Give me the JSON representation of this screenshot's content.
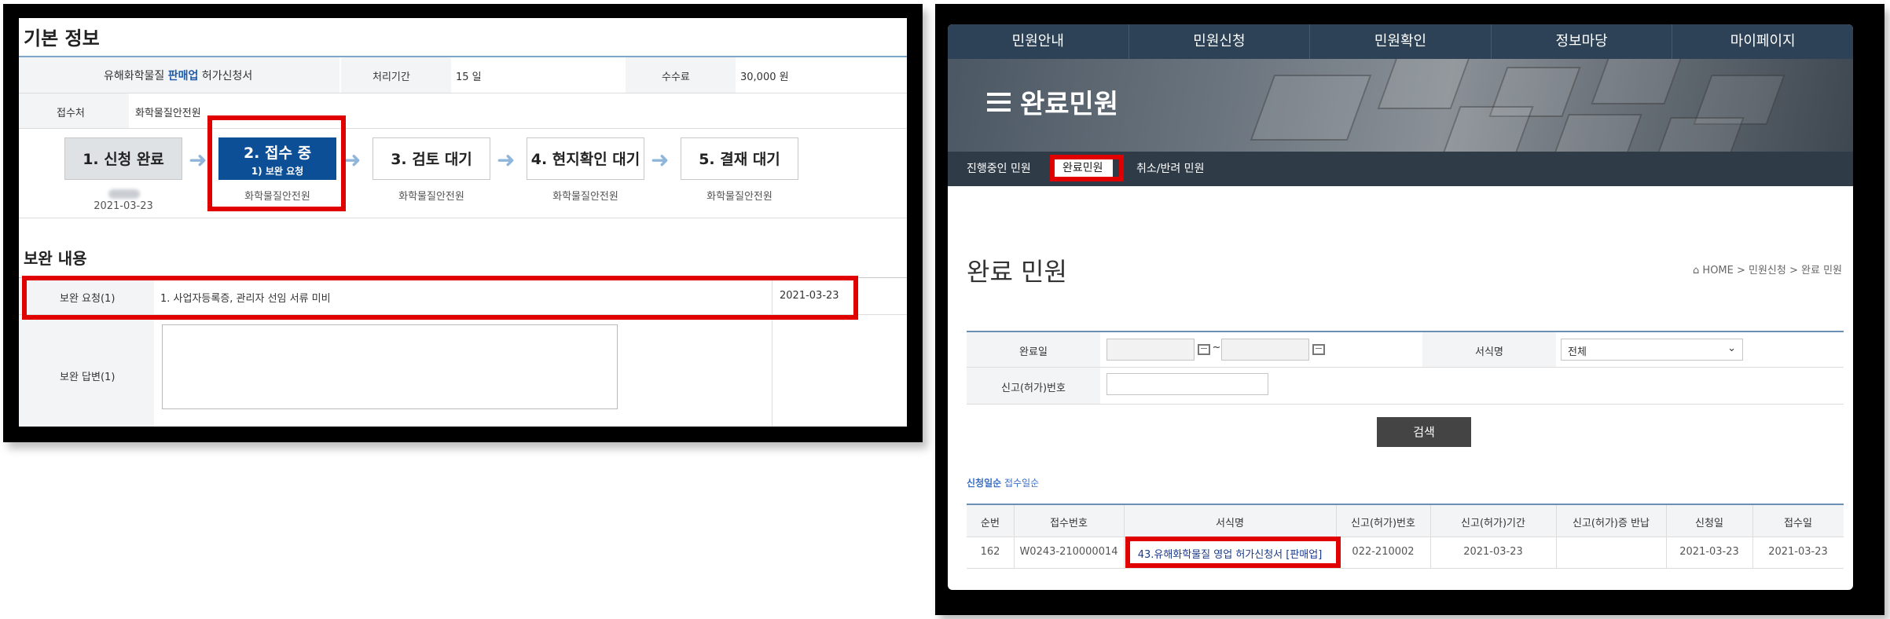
{
  "left": {
    "basic_info_title": "기본 정보",
    "form_name_prefix": "유해화학물질 ",
    "form_name_highlight": "판매업",
    "form_name_suffix": " 허가신청서",
    "processing_label": "처리기간",
    "processing_value": "15 일",
    "fee_label": "수수료",
    "fee_value": "30,000 원",
    "receiver_label": "접수처",
    "receiver_value": "화학물질안전원",
    "steps": [
      {
        "title": "1. 신청 완료",
        "sub": "",
        "under": "2021-03-23",
        "state": "done"
      },
      {
        "title": "2. 접수 중",
        "sub": "1) 보완 요청",
        "under": "화학물질안전원",
        "state": "active"
      },
      {
        "title": "3. 검토 대기",
        "sub": "",
        "under": "화학물질안전원",
        "state": "pending"
      },
      {
        "title": "4. 현지확인 대기",
        "sub": "",
        "under": "화학물질안전원",
        "state": "pending"
      },
      {
        "title": "5. 결재 대기",
        "sub": "",
        "under": "화학물질안전원",
        "state": "pending"
      }
    ],
    "supplement_title": "보완 내용",
    "supp_request_label": "보완 요청(1)",
    "supp_request_text": "1. 사업자등록증, 관리자 선임 서류 미비",
    "supp_request_date": "2021-03-23",
    "supp_answer_label": "보완 답변(1)"
  },
  "right": {
    "topnav": [
      "민원안내",
      "민원신청",
      "민원확인",
      "정보마당",
      "마이페이지"
    ],
    "hero_title": "완료민원",
    "subnav": [
      "진행중인 민원",
      "완료민원",
      "취소/반려 민원"
    ],
    "page_heading": "완료 민원",
    "breadcrumb": "HOME > 민원신청 > 완료 민원",
    "completed_date_label": "완료일",
    "date_separator": "~",
    "form_name_label": "서식명",
    "form_name_select": "전체",
    "report_no_label": "신고(허가)번호",
    "search_button": "검색",
    "sort_primary": "신청일순",
    "sort_secondary": "접수일순",
    "table": {
      "headers": [
        "순번",
        "접수번호",
        "서식명",
        "신고(허가)번호",
        "신고(허가)기간",
        "신고(허가)증 반납",
        "신청일",
        "접수일"
      ],
      "rows": [
        [
          "162",
          "W0243-210000014",
          "43.유해화학물질 영업 허가신청서 [판매업]",
          "022-210002",
          "2021-03-23",
          "",
          "2021-03-23",
          "2021-03-23"
        ]
      ]
    }
  }
}
